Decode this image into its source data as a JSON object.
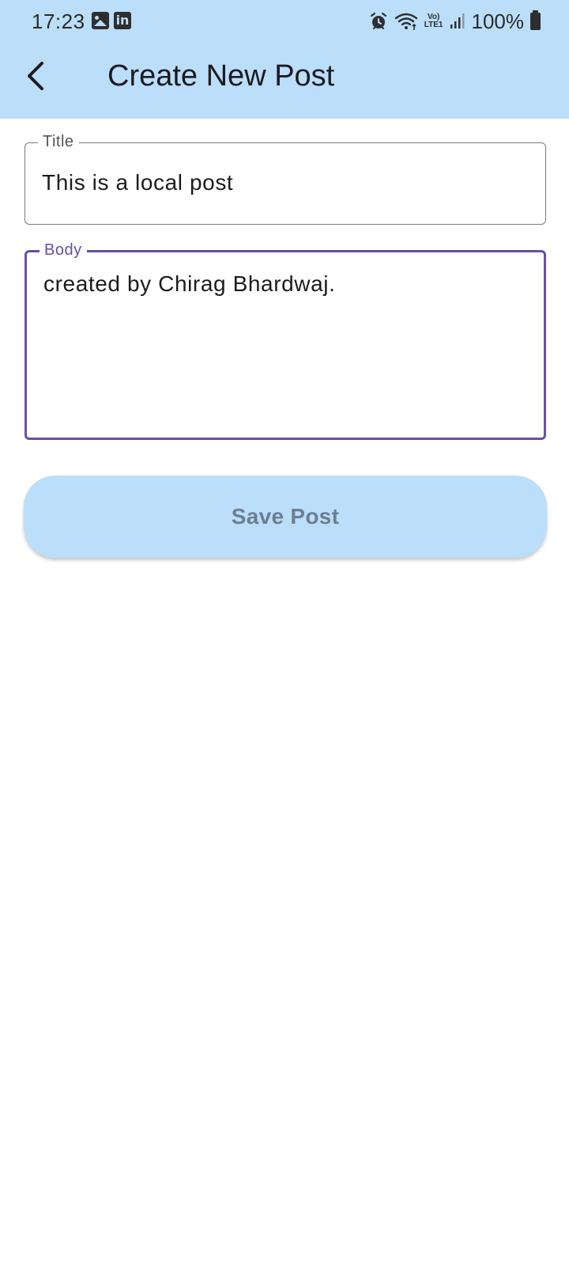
{
  "status_bar": {
    "time": "17:23",
    "battery": "100%",
    "network_label_top": "Vo)",
    "network_label_bottom": "LTE1",
    "icons_left": [
      "gallery-icon",
      "linkedin-icon"
    ],
    "icons_right": [
      "alarm-icon",
      "wifi-icon",
      "volte-icon",
      "signal-icon",
      "battery-icon"
    ]
  },
  "app_bar": {
    "title": "Create New Post",
    "back_icon": "back-arrow-icon"
  },
  "form": {
    "title_field": {
      "label": "Title",
      "value": "This is a local post"
    },
    "body_field": {
      "label": "Body",
      "value": "created by Chirag Bhardwaj."
    },
    "save_button_label": "Save Post"
  },
  "colors": {
    "app_bar_bg": "#bbdefb",
    "focus_accent": "#6750a4",
    "button_text": "#6b7f90"
  }
}
